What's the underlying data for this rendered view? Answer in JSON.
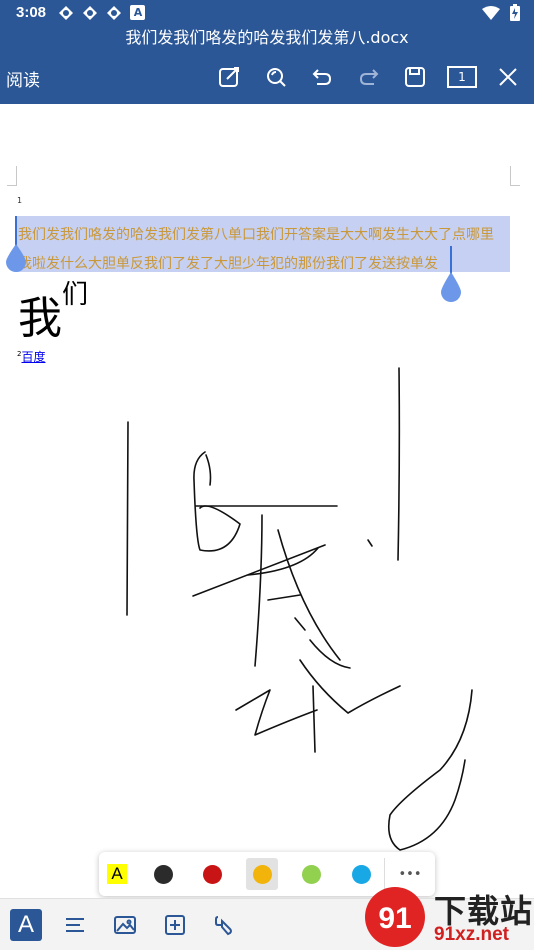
{
  "status_bar": {
    "time": "3:08",
    "notification_badge": "A"
  },
  "document": {
    "title": "我们发我们咯发的哈发我们发第八.docx"
  },
  "toolbar": {
    "read_label": "阅读",
    "page_indicator": "1",
    "icons": [
      "edit-icon",
      "search-icon",
      "undo-icon",
      "redo-icon",
      "save-icon",
      "page-indicator-icon",
      "close-icon"
    ]
  },
  "content": {
    "page_number_mark": "1",
    "selected_line_1": "我们发我们咯发的哈发我们发第八单口我们开答案是大大啊发生大大了点哪里",
    "selected_line_2": "我啦发什么大胆单反我们了发了大胆少年犯的那份我们了发送按单发",
    "big_text_main": "我",
    "big_text_sup": "们",
    "footnote_number": "2",
    "footnote_link": "百度"
  },
  "pen_bar": {
    "highlighter_label": "A",
    "colors": [
      "#2b2b2b",
      "#c81414",
      "#f2b40a",
      "#92d050",
      "#19a8e6"
    ],
    "selected_color_index": 2,
    "more_label": "•••"
  },
  "bottom_bar": {
    "font_button_label": "A",
    "icons": [
      "text-format-icon",
      "paragraph-icon",
      "image-icon",
      "insert-icon",
      "ink-icon"
    ]
  },
  "watermark": {
    "logo_text": "91",
    "site_name": "下载站",
    "url": "91xz.net"
  }
}
